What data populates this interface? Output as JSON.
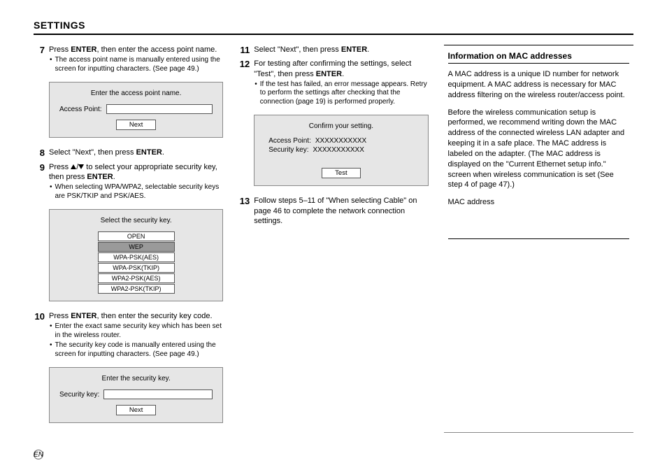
{
  "title": "SETTINGS",
  "col1": {
    "step7": {
      "num": "7",
      "text_a": "Press ",
      "text_b": "ENTER",
      "text_c": ", then enter the access point name.",
      "bullet1": "The access point name is manually entered using the screen for inputting characters. (See page 49.)"
    },
    "panel_ap": {
      "title": "Enter the access point name.",
      "label": "Access Point:",
      "button": "Next"
    },
    "step8": {
      "num": "8",
      "text_a": "Select \"Next\", then press ",
      "text_b": "ENTER",
      "text_c": "."
    },
    "step9": {
      "num": "9",
      "text_a": "Press ",
      "text_b": " to select your appropriate security key, then press ",
      "text_c": "ENTER",
      "text_d": ".",
      "bullet1": "When selecting WPA/WPA2, selectable security keys are PSK/TKIP and PSK/AES."
    },
    "panel_sec": {
      "title": "Select the security key.",
      "options": [
        "OPEN",
        "WEP",
        "WPA-PSK(AES)",
        "WPA-PSK(TKIP)",
        "WPA2-PSK(AES)",
        "WPA2-PSK(TKIP)"
      ]
    },
    "step10": {
      "num": "10",
      "text_a": "Press ",
      "text_b": "ENTER",
      "text_c": ", then enter the security key code.",
      "bullet1": "Enter the exact same security key which has been set in the wireless router.",
      "bullet2": "The security key code is manually entered using the screen for inputting characters. (See page 49.)"
    },
    "panel_key": {
      "title": "Enter the security key.",
      "label": "Security key:",
      "button": "Next"
    }
  },
  "col2": {
    "step11": {
      "num": "11",
      "text_a": "Select \"Next\", then press ",
      "text_b": "ENTER",
      "text_c": "."
    },
    "step12": {
      "num": "12",
      "text_a": "For testing after confirming the settings, select \"Test\", then press ",
      "text_b": "ENTER",
      "text_c": ".",
      "bullet1": "If the test has failed, an error message appears. Retry to perform the settings after checking that the connection (page 19) is performed properly."
    },
    "panel_confirm": {
      "title": "Confirm your setting.",
      "ap_label": "Access Point:",
      "ap_value": "XXXXXXXXXXX",
      "sk_label": "Security key:",
      "sk_value": "XXXXXXXXXXX",
      "button": "Test"
    },
    "step13": {
      "num": "13",
      "text": "Follow steps 5–11 of \"When selecting Cable\" on page 46 to complete the network connection settings."
    }
  },
  "col3": {
    "heading": "Information on MAC addresses",
    "p1": "A MAC address is a unique ID number for network equipment. A MAC address is necessary for MAC address filtering on the wireless router/access point.",
    "p2": "Before the wireless communication setup is performed, we recommend writing down the MAC address of the connected wireless LAN adapter and keeping it in a safe place. The MAC address is labeled on the adapter. (The MAC address is displayed on the \"Current Ethernet setup info.\" screen when wireless communication is set (See step 4 of page 47).)",
    "mac_label": "MAC address"
  },
  "footer": "EN"
}
